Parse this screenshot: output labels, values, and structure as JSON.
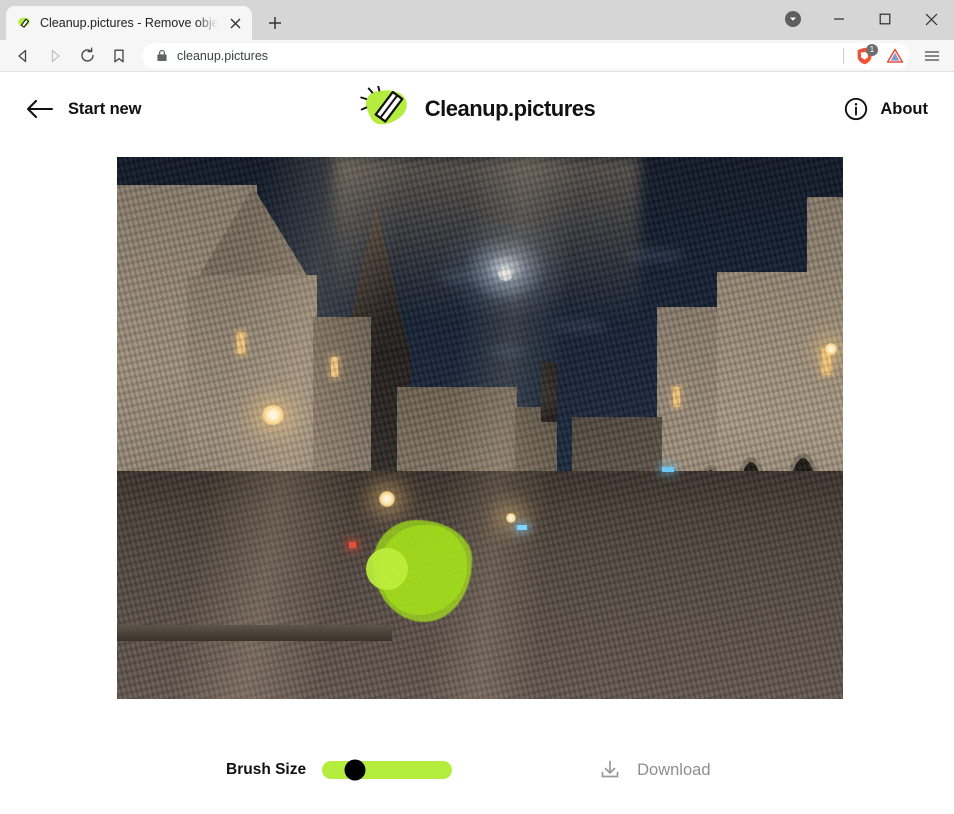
{
  "browser": {
    "tab": {
      "title": "Cleanup.pictures - Remove object",
      "favicon_name": "cleanup-eraser-favicon",
      "close_label": "✕"
    },
    "new_tab_label": "+",
    "window_controls": {
      "tab_search": "tab-search",
      "minimize": "–",
      "maximize": "□",
      "close": "✕"
    },
    "toolbar": {
      "back": "back",
      "forward": "forward",
      "reload": "reload",
      "bookmark": "bookmark",
      "menu": "menu",
      "url": "cleanup.pictures",
      "lock_icon": "lock-icon",
      "shield_badge": "1",
      "shield_icon": "brave-shields-icon",
      "rewards_icon": "brave-rewards-triangle-icon"
    }
  },
  "app": {
    "start_new_label": "Start new",
    "brand_name": "Cleanup.pictures",
    "about_label": "About"
  },
  "editor": {
    "brush_label": "Brush Size",
    "brush_value_percent": 25,
    "download_label": "Download",
    "download_enabled": false,
    "image_alt": "night-city-street-photo"
  },
  "colors": {
    "accent_green": "#b5ed3f",
    "mask_green": "#a8e818",
    "brush_cursor_green": "#bff03c",
    "text_dark": "#111111",
    "text_muted": "#8e8e8e",
    "tab_bar": "#d6d6d6",
    "toolbar": "#f6f6f6"
  }
}
